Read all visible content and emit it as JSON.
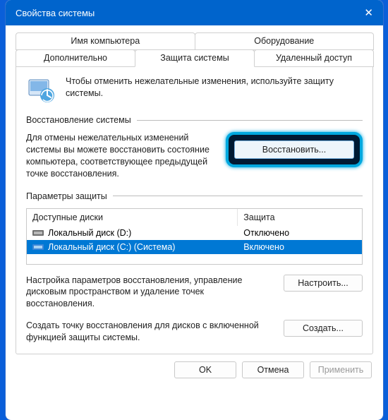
{
  "window": {
    "title": "Свойства системы"
  },
  "tabs": {
    "computer_name": "Имя компьютера",
    "hardware": "Оборудование",
    "advanced": "Дополнительно",
    "system_protection": "Защита системы",
    "remote": "Удаленный доступ"
  },
  "intro_text": "Чтобы отменить нежелательные изменения, используйте защиту системы.",
  "sections": {
    "restore_header": "Восстановление системы",
    "restore_text": "Для отмены нежелательных изменений системы вы можете восстановить состояние компьютера, соответствующее предыдущей точке восстановления.",
    "restore_button": "Восстановить...",
    "params_header": "Параметры защиты",
    "columns": {
      "drives": "Доступные диски",
      "protection": "Защита"
    },
    "drives": [
      {
        "name": "Локальный диск (D:)",
        "protection": "Отключено",
        "selected": false
      },
      {
        "name": "Локальный диск (C:) (Система)",
        "protection": "Включено",
        "selected": true
      }
    ],
    "configure_text": "Настройка параметров восстановления, управление дисковым пространством и удаление точек восстановления.",
    "configure_button": "Настроить...",
    "create_text": "Создать точку восстановления для дисков с включенной функцией защиты системы.",
    "create_button": "Создать..."
  },
  "footer": {
    "ok": "OK",
    "cancel": "Отмена",
    "apply": "Применить"
  }
}
